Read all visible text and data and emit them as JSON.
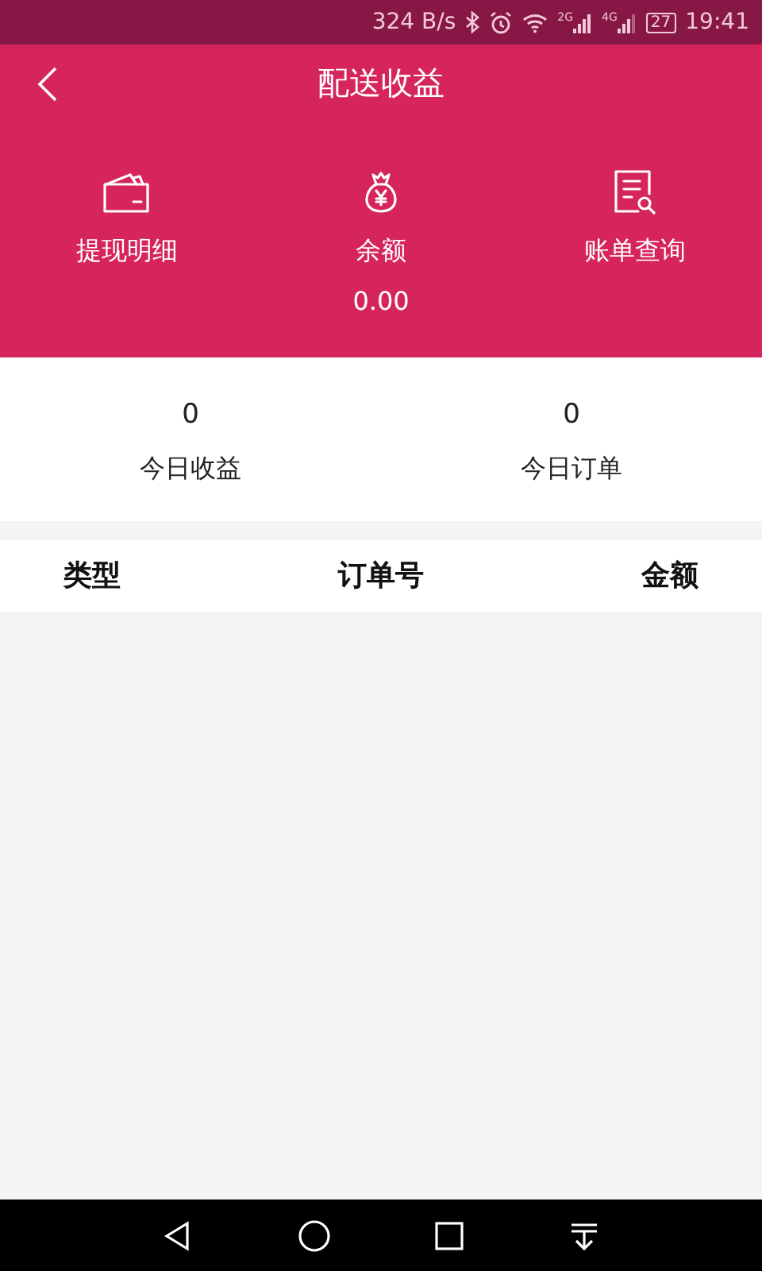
{
  "status_bar": {
    "speed": "324 B/s",
    "sim1": "2G",
    "sim2": "4G",
    "battery": "27",
    "time": "19:41"
  },
  "header": {
    "title": "配送收益"
  },
  "actions": [
    {
      "kind": "wallet",
      "label": "提现明细"
    },
    {
      "kind": "moneybag",
      "label": "余额",
      "value": "0.00"
    },
    {
      "kind": "bill",
      "label": "账单查询"
    }
  ],
  "stats": [
    {
      "value": "0",
      "label": "今日收益"
    },
    {
      "value": "0",
      "label": "今日订单"
    }
  ],
  "table": {
    "columns": [
      "类型",
      "订单号",
      "金额"
    ]
  }
}
